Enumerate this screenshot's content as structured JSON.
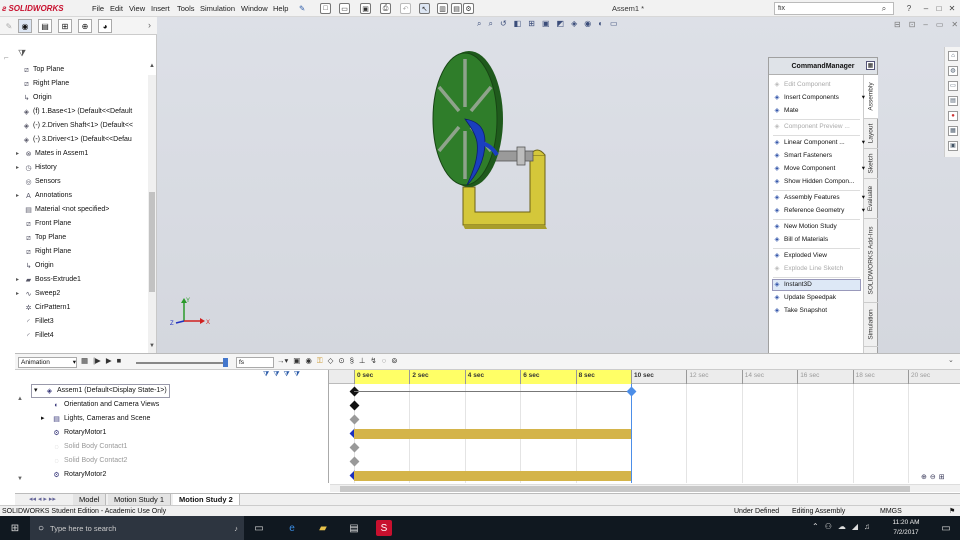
{
  "app": {
    "brand": "SOLIDWORKS",
    "doc_title": "Assem1 *"
  },
  "menu": [
    "File",
    "Edit",
    "View",
    "Insert",
    "Tools",
    "Simulation",
    "Window",
    "Help"
  ],
  "search": {
    "value": "fix"
  },
  "window_buttons": [
    "?",
    "–",
    "□",
    "✕"
  ],
  "feature_tree": [
    {
      "label": "Top Plane",
      "icon": "plane-icon",
      "indent": 1,
      "expand": ""
    },
    {
      "label": "Right Plane",
      "icon": "plane-icon",
      "indent": 1,
      "expand": ""
    },
    {
      "label": "Origin",
      "icon": "origin-icon",
      "indent": 1,
      "expand": ""
    },
    {
      "label": "(f) 1.Base<1> (Default<<Default",
      "icon": "part-icon",
      "indent": 1,
      "expand": ""
    },
    {
      "label": "(-) 2.Driven Shaft<1> (Default<<",
      "icon": "part-icon",
      "indent": 1,
      "expand": ""
    },
    {
      "label": "(-) 3.Driver<1> (Default<<Defau",
      "icon": "part-icon",
      "indent": 1,
      "expand": ""
    },
    {
      "label": "Mates in Assem1",
      "icon": "mates-icon",
      "indent": 2,
      "expand": "▸"
    },
    {
      "label": "History",
      "icon": "history-icon",
      "indent": 2,
      "expand": "▸"
    },
    {
      "label": "Sensors",
      "icon": "sensor-icon",
      "indent": 2,
      "expand": ""
    },
    {
      "label": "Annotations",
      "icon": "annotation-icon",
      "indent": 2,
      "expand": "▸"
    },
    {
      "label": "Material <not specified>",
      "icon": "material-icon",
      "indent": 2,
      "expand": ""
    },
    {
      "label": "Front Plane",
      "icon": "plane-icon",
      "indent": 2,
      "expand": ""
    },
    {
      "label": "Top Plane",
      "icon": "plane-icon",
      "indent": 2,
      "expand": ""
    },
    {
      "label": "Right Plane",
      "icon": "plane-icon",
      "indent": 2,
      "expand": ""
    },
    {
      "label": "Origin",
      "icon": "origin-icon",
      "indent": 2,
      "expand": ""
    },
    {
      "label": "Boss-Extrude1",
      "icon": "extrude-icon",
      "indent": 2,
      "expand": "▸"
    },
    {
      "label": "Sweep2",
      "icon": "sweep-icon",
      "indent": 2,
      "expand": "▸"
    },
    {
      "label": "CirPattern1",
      "icon": "pattern-icon",
      "indent": 2,
      "expand": ""
    },
    {
      "label": "Fillet3",
      "icon": "fillet-icon",
      "indent": 2,
      "expand": ""
    },
    {
      "label": "Fillet4",
      "icon": "fillet-icon",
      "indent": 2,
      "expand": ""
    }
  ],
  "command_manager": {
    "title": "CommandManager",
    "items": [
      {
        "label": "Edit Component",
        "disabled": true,
        "icon": "edit-component-icon"
      },
      {
        "label": "Insert Components",
        "disabled": false,
        "icon": "insert-components-icon",
        "arrow": true
      },
      {
        "label": "Mate",
        "disabled": false,
        "icon": "mate-icon"
      },
      {
        "label": "Component Preview ...",
        "disabled": true,
        "icon": "preview-icon"
      },
      {
        "label": "Linear Component ...",
        "disabled": false,
        "icon": "linear-pattern-icon",
        "arrow": true
      },
      {
        "label": "Smart Fasteners",
        "disabled": false,
        "icon": "fastener-icon"
      },
      {
        "label": "Move Component",
        "disabled": false,
        "icon": "move-icon",
        "arrow": true
      },
      {
        "label": "Show Hidden Compon...",
        "disabled": false,
        "icon": "show-hidden-icon"
      },
      {
        "label": "Assembly Features",
        "disabled": false,
        "icon": "assembly-features-icon",
        "arrow": true
      },
      {
        "label": "Reference Geometry",
        "disabled": false,
        "icon": "reference-geometry-icon",
        "arrow": true
      },
      {
        "label": "New Motion Study",
        "disabled": false,
        "icon": "motion-study-icon"
      },
      {
        "label": "Bill of Materials",
        "disabled": false,
        "icon": "bom-icon"
      },
      {
        "label": "Exploded View",
        "disabled": false,
        "icon": "exploded-view-icon"
      },
      {
        "label": "Explode Line Sketch",
        "disabled": true,
        "icon": "explode-line-icon"
      },
      {
        "label": "Instant3D",
        "disabled": false,
        "icon": "instant3d-icon",
        "selected": true
      },
      {
        "label": "Update Speedpak",
        "disabled": false,
        "icon": "speedpak-icon"
      },
      {
        "label": "Take Snapshot",
        "disabled": false,
        "icon": "snapshot-icon"
      }
    ],
    "tabs": [
      "Assembly",
      "Layout",
      "Sketch",
      "Evaluate",
      "SOLIDWORKS Add-Ins",
      "Simulation"
    ]
  },
  "motion": {
    "type": "Animation",
    "fps": "fs",
    "tree": [
      {
        "label": "Assem1  (Default<Display State-1>)",
        "indent": 0,
        "icon": "assembly-icon",
        "disabled": false,
        "expand": "▾"
      },
      {
        "label": "Orientation and Camera Views",
        "indent": 1,
        "icon": "camera-icon",
        "disabled": false,
        "expand": ""
      },
      {
        "label": "Lights, Cameras and Scene",
        "indent": 1,
        "icon": "lights-icon",
        "disabled": false,
        "expand": "▸"
      },
      {
        "label": "RotaryMotor1",
        "indent": 1,
        "icon": "motor-icon",
        "disabled": false,
        "expand": ""
      },
      {
        "label": "Solid Body Contact1",
        "indent": 1,
        "icon": "contact-icon",
        "disabled": true,
        "expand": ""
      },
      {
        "label": "Solid Body Contact2",
        "indent": 1,
        "icon": "contact-icon",
        "disabled": true,
        "expand": ""
      },
      {
        "label": "RotaryMotor2",
        "indent": 1,
        "icon": "motor-icon",
        "disabled": false,
        "expand": ""
      }
    ],
    "ticks": [
      "0 sec",
      "2 sec",
      "4 sec",
      "6 sec",
      "8 sec",
      "10 sec",
      "12 sec",
      "14 sec",
      "16 sec",
      "18 sec",
      "20 sec"
    ],
    "active_until_sec": 10
  },
  "bottom_tabs": [
    "Model",
    "Motion Study 1",
    "Motion Study 2"
  ],
  "active_tab": "Motion Study 2",
  "status": {
    "left": "SOLIDWORKS Student Edition - Academic Use Only",
    "under_defined": "Under Defined",
    "editing": "Editing Assembly",
    "units": "MMGS"
  },
  "taskbar": {
    "search_placeholder": "Type here to search",
    "time": "11:20 AM",
    "date": "7/2/2017"
  },
  "colors": {
    "brand": "#c8102e",
    "timeline_highlight": "#ffff66",
    "motor_bar": "#d4b44a",
    "wheel": "#2f7d2a",
    "frame": "#d4c73a",
    "sweep": "#1a3fbf"
  }
}
